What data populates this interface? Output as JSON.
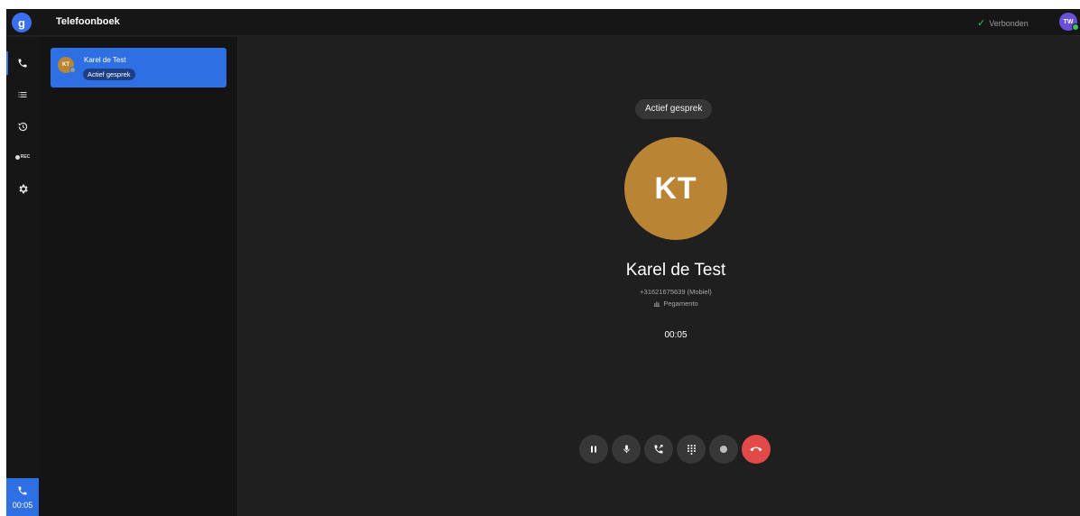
{
  "app": {
    "logo_letter": "g",
    "title": "Telefoonboek",
    "connection_status": "Verbonden",
    "user_initials": "TW",
    "colors": {
      "accent": "#2f6fe4",
      "avatar": "#b98534",
      "hangup": "#e24a4a",
      "online": "#3fbf5f"
    }
  },
  "rail": {
    "items": [
      {
        "name": "phone-icon",
        "active": true
      },
      {
        "name": "list-icon"
      },
      {
        "name": "history-icon"
      },
      {
        "name": "recordings-icon",
        "label": "REC"
      },
      {
        "name": "settings-icon"
      }
    ],
    "active_call_timer": "00:05"
  },
  "contacts": [
    {
      "initials": "KT",
      "name": "Karel de Test",
      "badge": "Actief gesprek"
    }
  ],
  "call": {
    "status": "Actief gesprek",
    "initials": "KT",
    "name": "Karel de Test",
    "phone": "+31621675639",
    "phone_type": "(Mobiel)",
    "company": "Pegamento",
    "duration": "00:05",
    "controls": [
      {
        "name": "pause-icon"
      },
      {
        "name": "microphone-icon"
      },
      {
        "name": "transfer-icon"
      },
      {
        "name": "dialpad-icon"
      },
      {
        "name": "record-icon"
      },
      {
        "name": "hangup-icon"
      }
    ]
  }
}
